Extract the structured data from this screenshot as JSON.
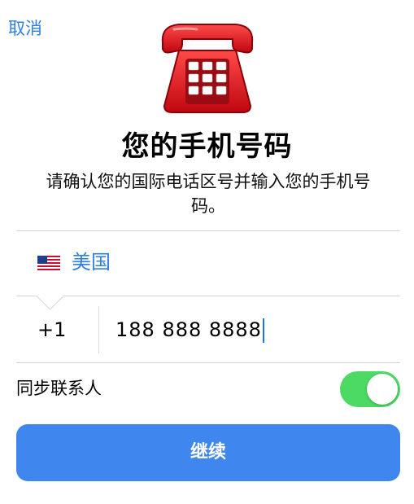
{
  "header": {
    "cancel_label": "取消"
  },
  "main": {
    "title": "您的手机号码",
    "subtitle": "请确认您的国际电话区号并输入您的手机号码。"
  },
  "country": {
    "flag_icon": "us-flag-icon",
    "name": "美国"
  },
  "phone": {
    "country_code": "+1",
    "number": "188 888 8888"
  },
  "sync_contacts": {
    "label": "同步联系人",
    "enabled": true
  },
  "continue_button": {
    "label": "继续"
  },
  "colors": {
    "accent": "#2f7fe0",
    "button": "#3f86ee",
    "toggle_on": "#4cd964",
    "phone_icon": "#e0141c"
  },
  "icons": {
    "phone": "telephone-icon"
  }
}
